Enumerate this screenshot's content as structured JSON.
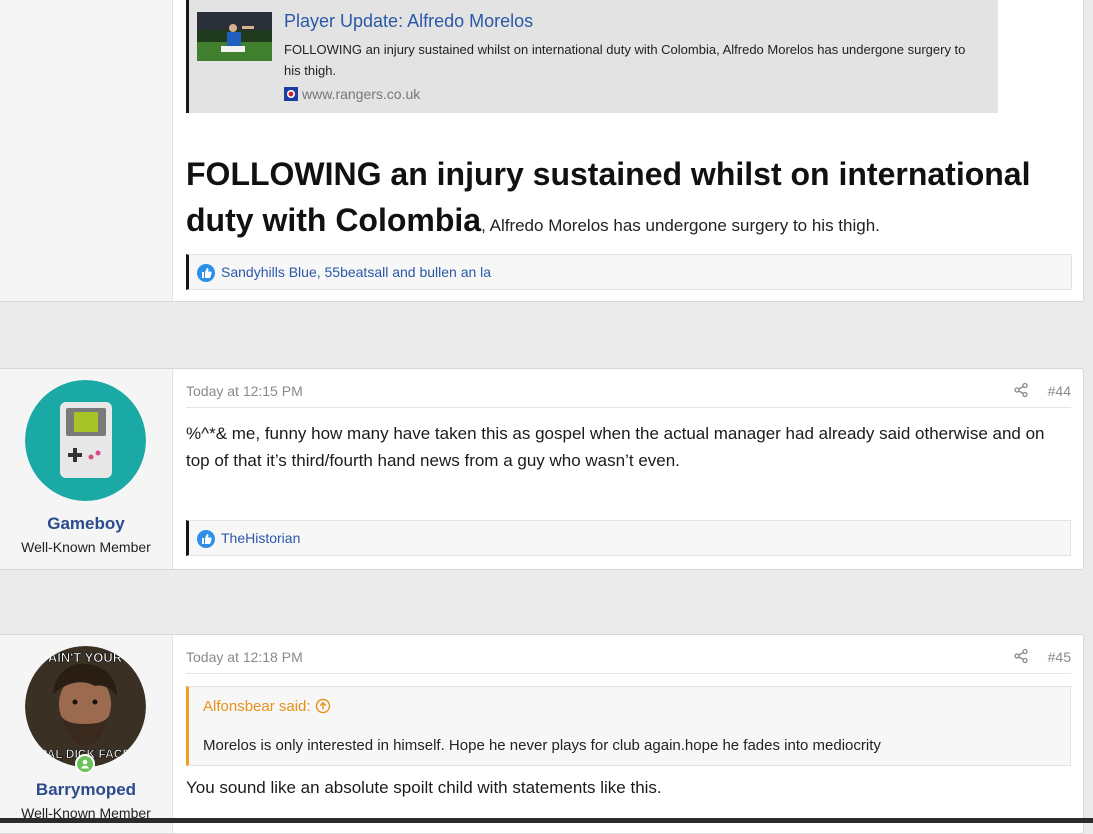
{
  "post_prev": {
    "embed": {
      "title": "Player Update: Alfredo Morelos",
      "description": "FOLLOWING an injury sustained whilst on international duty with Colombia, Alfredo Morelos has undergone surgery to his thigh.",
      "source": "www.rangers.co.uk"
    },
    "headline_bold": "FOLLOWING an injury sustained whilst on international duty with Colombia",
    "headline_tail": ", Alfredo Morelos has undergone surgery to his thigh.",
    "reactions": "Sandyhills Blue, 55beatsall and bullen an la"
  },
  "post_44": {
    "username": "Gameboy",
    "user_title": "Well-Known Member",
    "date": "Today at 12:15 PM",
    "number": "#44",
    "body": "%^*& me, funny how many have taken this as gospel when the actual manager had already said otherwise and on top of that it’s third/fourth hand news from a guy who wasn’t even.",
    "reactions": "TheHistorian",
    "avatar_color": "#1aa9a5"
  },
  "post_45": {
    "username": "Barrymoped",
    "user_title": "Well-Known Member",
    "date": "Today at 12:18 PM",
    "number": "#45",
    "avatar_text_top": "AIN'T YOUR",
    "avatar_text_bottom": "PAL DICK FACE",
    "quote_author": "Alfonsbear said:",
    "quote_body": "Morelos is only interested in himself. Hope he never plays for club again.hope he fades into mediocrity",
    "body": "You sound like an absolute spoilt child with statements like this."
  },
  "colors": {
    "link": "#2a58a8",
    "username": "#2a4b8d",
    "quote_accent": "#f0a020",
    "like": "#2d8fe6",
    "online": "#6ac259"
  }
}
